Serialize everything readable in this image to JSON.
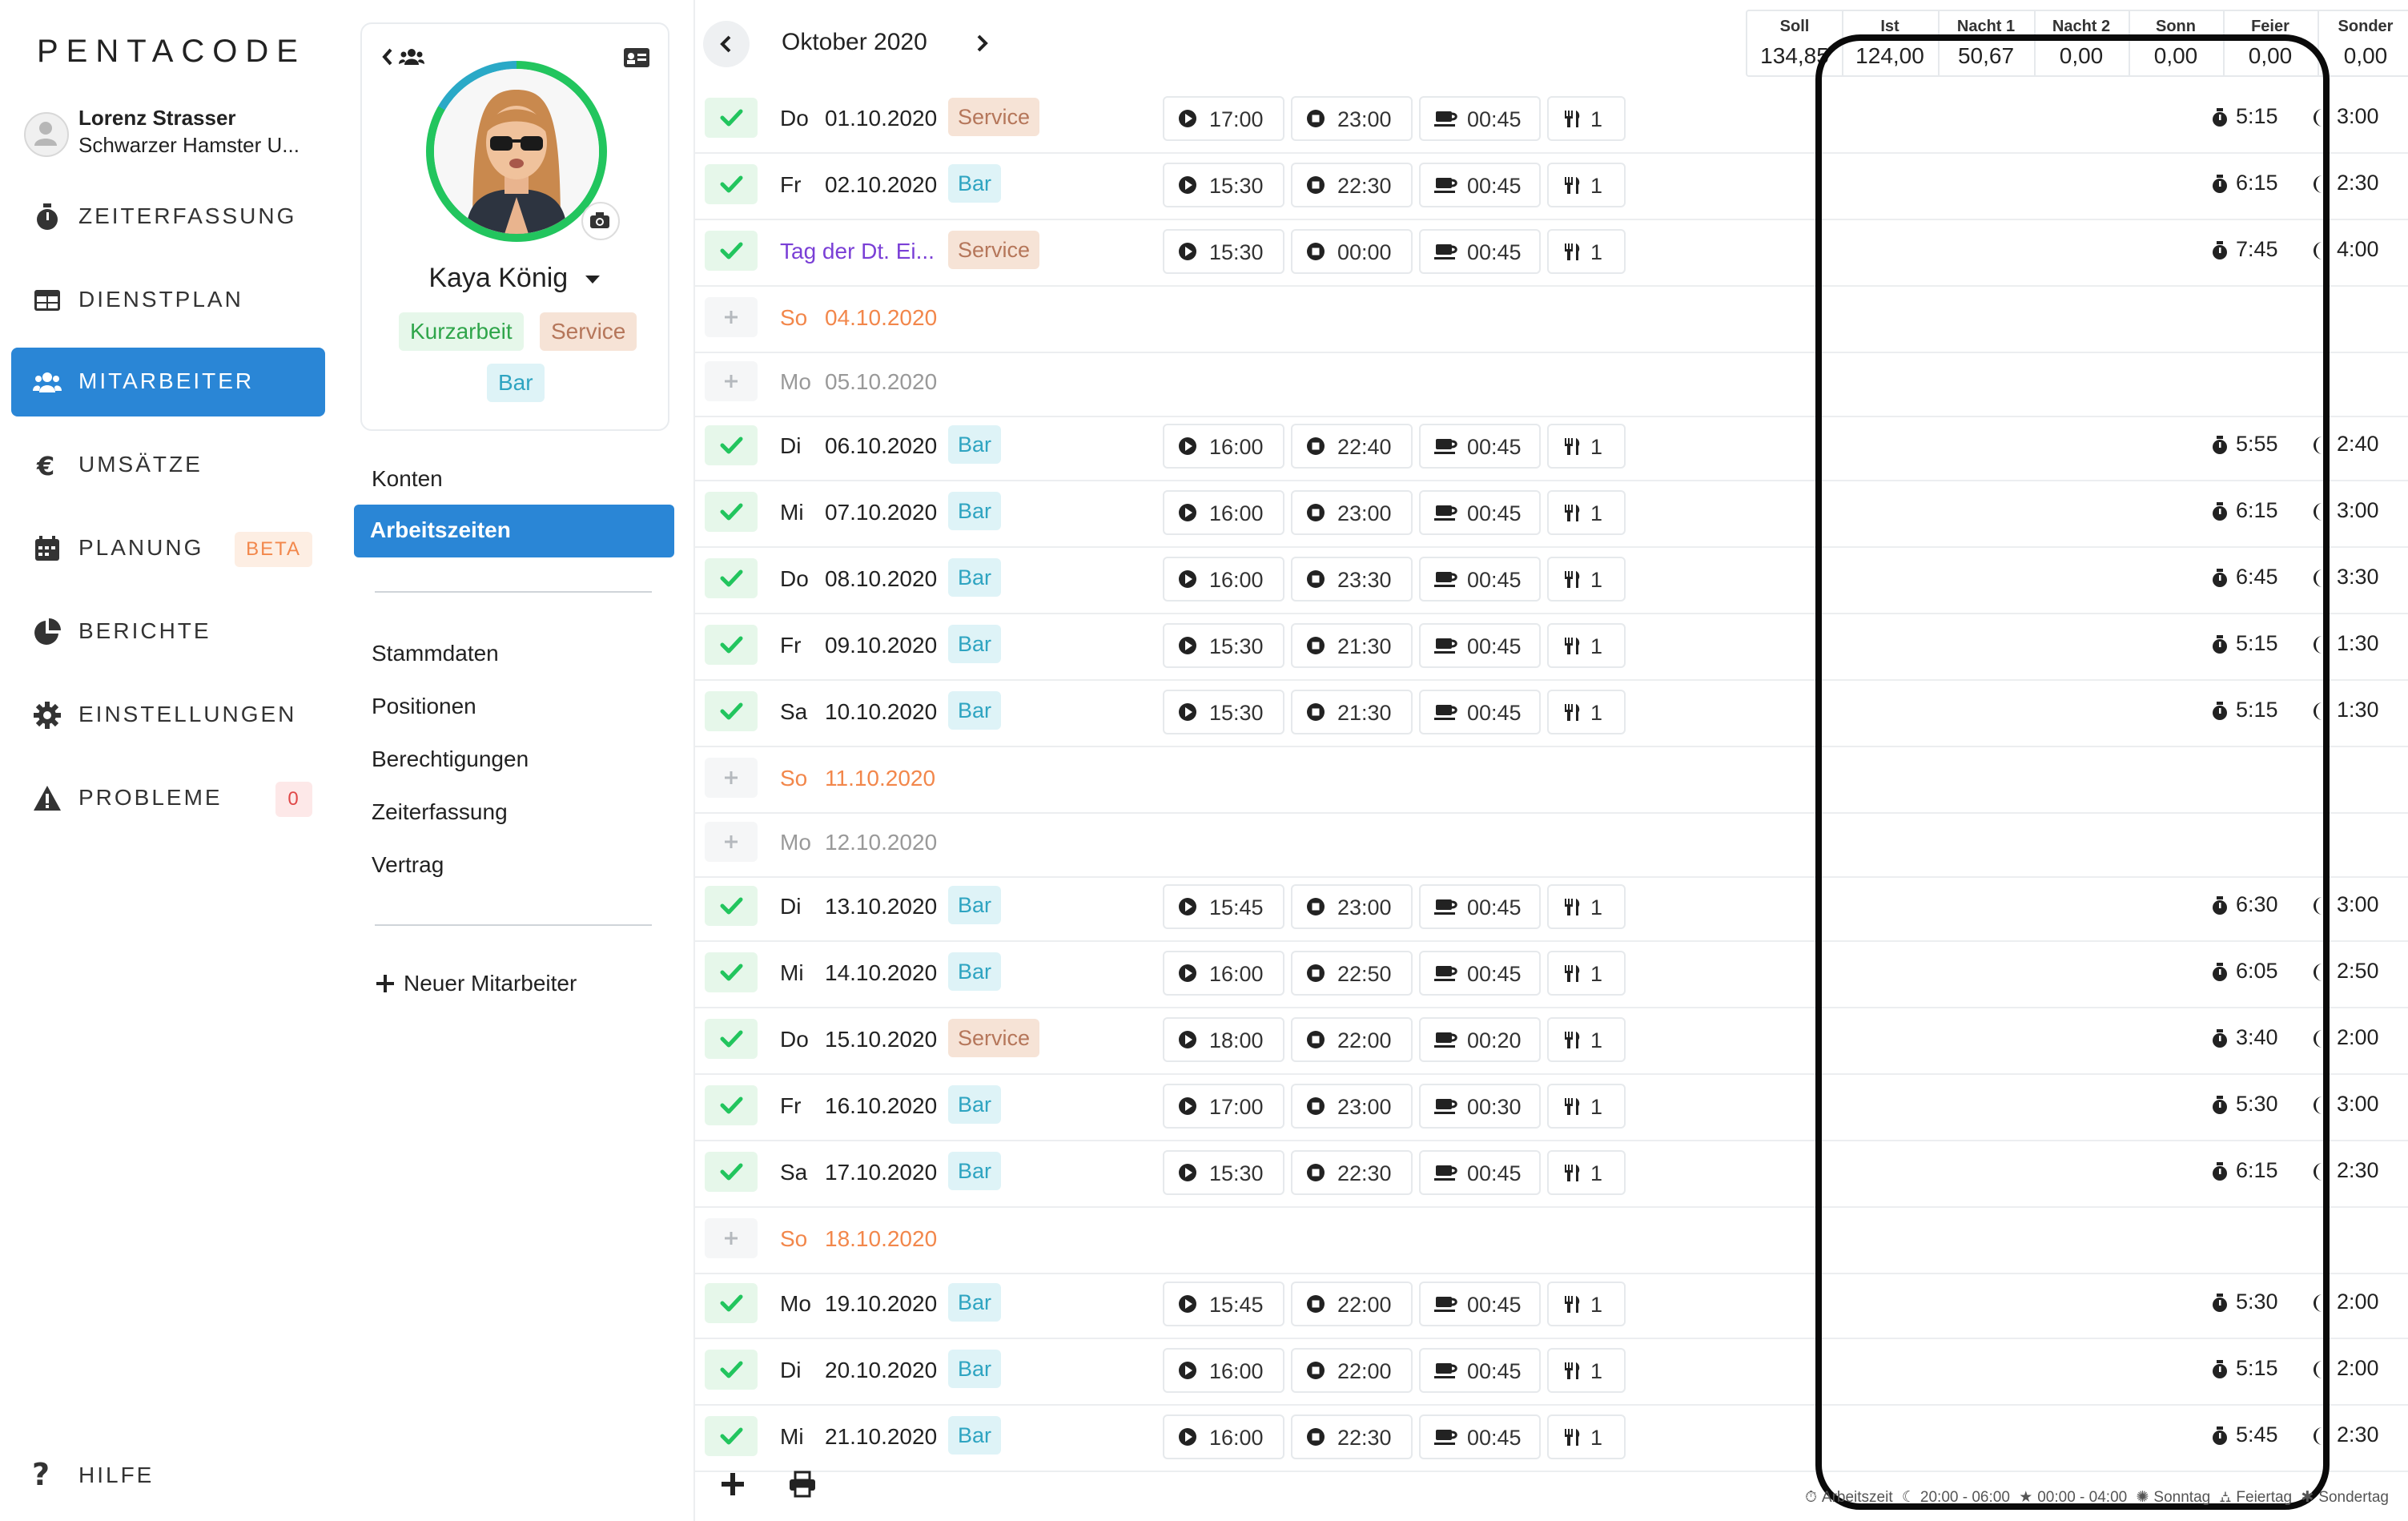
{
  "app": {
    "logo": "PENTACODE"
  },
  "user": {
    "name": "Lorenz Strasser",
    "company": "Schwarzer Hamster U..."
  },
  "nav": {
    "items": [
      {
        "label": "ZEITERFASSUNG",
        "icon": "stopwatch-icon"
      },
      {
        "label": "DIENSTPLAN",
        "icon": "table-icon"
      },
      {
        "label": "MITARBEITER",
        "icon": "users-icon",
        "active": true
      },
      {
        "label": "UMSÄTZE",
        "icon": "euro-icon"
      },
      {
        "label": "PLANUNG",
        "icon": "calendar-icon",
        "badge": "BETA"
      },
      {
        "label": "BERICHTE",
        "icon": "pie-chart-icon"
      },
      {
        "label": "EINSTELLUNGEN",
        "icon": "gear-icon"
      },
      {
        "label": "PROBLEME",
        "icon": "warning-icon",
        "badge": "0"
      }
    ],
    "help": "HILFE"
  },
  "employee": {
    "name": "Kaya König",
    "tags": [
      "Kurzarbeit",
      "Service",
      "Bar"
    ],
    "sub_nav": {
      "konten": "Konten",
      "arbeitszeiten": "Arbeitszeiten",
      "stammdaten": "Stammdaten",
      "positionen": "Positionen",
      "berechtigungen": "Berechtigungen",
      "zeiterfassung": "Zeiterfassung",
      "vertrag": "Vertrag"
    },
    "new_employee": "Neuer Mitarbeiter"
  },
  "month": "Oktober 2020",
  "summary": [
    {
      "label": "Soll",
      "value": "134,85"
    },
    {
      "label": "Ist",
      "value": "124,00"
    },
    {
      "label": "Nacht 1",
      "value": "50,67"
    },
    {
      "label": "Nacht 2",
      "value": "0,00"
    },
    {
      "label": "Sonn",
      "value": "0,00"
    },
    {
      "label": "Feier",
      "value": "0,00"
    },
    {
      "label": "Sonder",
      "value": "0,00"
    }
  ],
  "rows": [
    {
      "type": "work",
      "day": "Do",
      "date": "01.10.2020",
      "position": "Service",
      "start": "17:00",
      "end": "23:00",
      "break": "00:45",
      "meals": "1",
      "worktime": "5:15",
      "night": "3:00"
    },
    {
      "type": "work",
      "day": "Fr",
      "date": "02.10.2020",
      "position": "Bar",
      "start": "15:30",
      "end": "22:30",
      "break": "00:45",
      "meals": "1",
      "worktime": "6:15",
      "night": "2:30"
    },
    {
      "type": "work",
      "holiday": true,
      "day": "",
      "date": "Tag der Dt. Ei...",
      "position": "Service",
      "start": "15:30",
      "end": "00:00",
      "break": "00:45",
      "meals": "1",
      "worktime": "7:45",
      "night": "4:00"
    },
    {
      "type": "sunday",
      "day": "So",
      "date": "04.10.2020"
    },
    {
      "type": "off",
      "day": "Mo",
      "date": "05.10.2020"
    },
    {
      "type": "work",
      "day": "Di",
      "date": "06.10.2020",
      "position": "Bar",
      "start": "16:00",
      "end": "22:40",
      "break": "00:45",
      "meals": "1",
      "worktime": "5:55",
      "night": "2:40"
    },
    {
      "type": "work",
      "day": "Mi",
      "date": "07.10.2020",
      "position": "Bar",
      "start": "16:00",
      "end": "23:00",
      "break": "00:45",
      "meals": "1",
      "worktime": "6:15",
      "night": "3:00"
    },
    {
      "type": "work",
      "day": "Do",
      "date": "08.10.2020",
      "position": "Bar",
      "start": "16:00",
      "end": "23:30",
      "break": "00:45",
      "meals": "1",
      "worktime": "6:45",
      "night": "3:30"
    },
    {
      "type": "work",
      "day": "Fr",
      "date": "09.10.2020",
      "position": "Bar",
      "start": "15:30",
      "end": "21:30",
      "break": "00:45",
      "meals": "1",
      "worktime": "5:15",
      "night": "1:30"
    },
    {
      "type": "work",
      "day": "Sa",
      "date": "10.10.2020",
      "position": "Bar",
      "start": "15:30",
      "end": "21:30",
      "break": "00:45",
      "meals": "1",
      "worktime": "5:15",
      "night": "1:30"
    },
    {
      "type": "sunday",
      "day": "So",
      "date": "11.10.2020"
    },
    {
      "type": "off",
      "day": "Mo",
      "date": "12.10.2020"
    },
    {
      "type": "work",
      "day": "Di",
      "date": "13.10.2020",
      "position": "Bar",
      "start": "15:45",
      "end": "23:00",
      "break": "00:45",
      "meals": "1",
      "worktime": "6:30",
      "night": "3:00"
    },
    {
      "type": "work",
      "day": "Mi",
      "date": "14.10.2020",
      "position": "Bar",
      "start": "16:00",
      "end": "22:50",
      "break": "00:45",
      "meals": "1",
      "worktime": "6:05",
      "night": "2:50"
    },
    {
      "type": "work",
      "day": "Do",
      "date": "15.10.2020",
      "position": "Service",
      "start": "18:00",
      "end": "22:00",
      "break": "00:20",
      "meals": "1",
      "worktime": "3:40",
      "night": "2:00"
    },
    {
      "type": "work",
      "day": "Fr",
      "date": "16.10.2020",
      "position": "Bar",
      "start": "17:00",
      "end": "23:00",
      "break": "00:30",
      "meals": "1",
      "worktime": "5:30",
      "night": "3:00"
    },
    {
      "type": "work",
      "day": "Sa",
      "date": "17.10.2020",
      "position": "Bar",
      "start": "15:30",
      "end": "22:30",
      "break": "00:45",
      "meals": "1",
      "worktime": "6:15",
      "night": "2:30"
    },
    {
      "type": "sunday",
      "day": "So",
      "date": "18.10.2020"
    },
    {
      "type": "work",
      "day": "Mo",
      "date": "19.10.2020",
      "position": "Bar",
      "start": "15:45",
      "end": "22:00",
      "break": "00:45",
      "meals": "1",
      "worktime": "5:30",
      "night": "2:00"
    },
    {
      "type": "work",
      "day": "Di",
      "date": "20.10.2020",
      "position": "Bar",
      "start": "16:00",
      "end": "22:00",
      "break": "00:45",
      "meals": "1",
      "worktime": "5:15",
      "night": "2:00"
    },
    {
      "type": "work",
      "day": "Mi",
      "date": "21.10.2020",
      "position": "Bar",
      "start": "16:00",
      "end": "22:30",
      "break": "00:45",
      "meals": "1",
      "worktime": "5:45",
      "night": "2:30"
    }
  ],
  "legend": {
    "arbeitszeit": "Arbeitszeit",
    "nacht1": "20:00 - 06:00",
    "nacht2": "00:00 - 04:00",
    "sonntag": "Sonntag",
    "feiertag": "Feiertag",
    "sondertag": "Sondertag"
  },
  "colors": {
    "accent": "#2a86d6",
    "green": "#22c55e",
    "service": "#b5765a",
    "bar": "#2ea4c1",
    "sunday": "#f2874b",
    "holiday": "#7a3fd6"
  }
}
